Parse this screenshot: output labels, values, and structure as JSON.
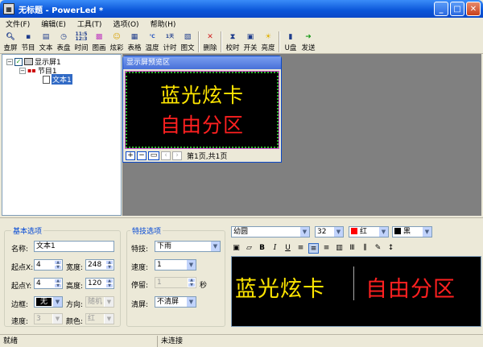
{
  "window": {
    "title": "无标题 - PowerLed *"
  },
  "menu": [
    "文件(F)",
    "编辑(E)",
    "工具(T)",
    "选项(O)",
    "帮助(H)"
  ],
  "toolbar": [
    {
      "label": "查屏",
      "icon": "search-icon"
    },
    {
      "label": "节目",
      "icon": "program-icon"
    },
    {
      "label": "文本",
      "icon": "text-doc-icon"
    },
    {
      "label": "表盘",
      "icon": "clock-icon"
    },
    {
      "label": "时间",
      "icon": "digital-time-icon",
      "glyph": "11:5\n12:3"
    },
    {
      "label": "图画",
      "icon": "picture-icon"
    },
    {
      "label": "炫彩",
      "icon": "smiley-icon"
    },
    {
      "label": "表格",
      "icon": "table-icon"
    },
    {
      "label": "温度",
      "icon": "temperature-icon",
      "glyph": "℃"
    },
    {
      "label": "计时",
      "icon": "timer-icon",
      "glyph": "1天"
    },
    {
      "label": "图文",
      "icon": "image-text-icon"
    },
    {
      "label": "删除",
      "icon": "delete-icon"
    },
    {
      "label": "校时",
      "icon": "hourglass-icon"
    },
    {
      "label": "开关",
      "icon": "monitor-icon"
    },
    {
      "label": "亮度",
      "icon": "bulb-icon"
    },
    {
      "label": "U盘",
      "icon": "usb-icon"
    },
    {
      "label": "发送",
      "icon": "send-arrow-icon"
    }
  ],
  "tree": {
    "root": "显示屏1",
    "program": "节目1",
    "text": "文本1"
  },
  "preview": {
    "title": "显示屏预览区",
    "line1": "蓝光炫卡",
    "line2": "自由分区",
    "page_info": "第1页,共1页"
  },
  "basic": {
    "title": "基本选项",
    "name_label": "名称:",
    "name_value": "文本1",
    "x_label": "起点X:",
    "x_value": "4",
    "width_label": "宽度:",
    "width_value": "248",
    "y_label": "起点Y:",
    "y_value": "4",
    "height_label": "高度:",
    "height_value": "120",
    "border_label": "边框:",
    "border_value": "无",
    "direction_label": "方向:",
    "direction_value": "随机",
    "speed_label": "速度:",
    "speed_value": "3",
    "color_label": "颜色:",
    "color_value": "红"
  },
  "effect": {
    "title": "特技选项",
    "effect_label": "特技:",
    "effect_value": "下雨",
    "speed_label": "速度:",
    "speed_value": "1",
    "stay_label": "停留:",
    "stay_value": "1",
    "stay_unit": "秒",
    "clear_label": "清屏:",
    "clear_value": "不清屏"
  },
  "editor": {
    "font": "幼圆",
    "size": "32",
    "fg_color_name": "红",
    "fg_color": "#ff0000",
    "bg_color_name": "黑",
    "bg_color": "#000000",
    "format_buttons": [
      "B",
      "I",
      "U"
    ],
    "text_left": "蓝光炫卡",
    "text_right": "自由分区"
  },
  "colors": {
    "yellow": "#ffe600",
    "red": "#ff2020"
  },
  "status": {
    "ready": "就绪",
    "conn": "未连接"
  }
}
